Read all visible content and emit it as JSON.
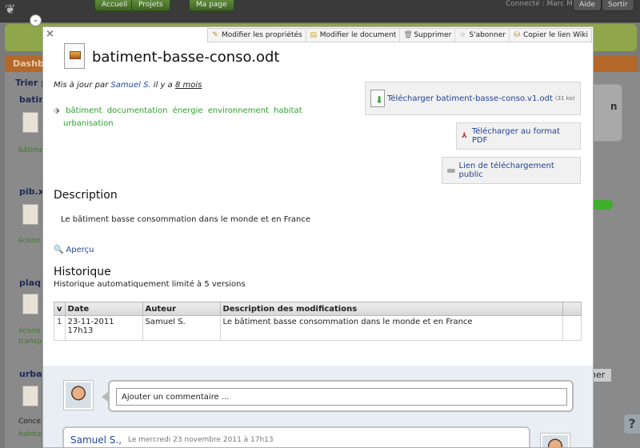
{
  "topbar": {
    "nav": [
      "Accueil",
      "Projets",
      "Ma page"
    ],
    "connected_text": "Connecté : Marc M.",
    "help": "Aide",
    "logout": "Sortir"
  },
  "background": {
    "orangebar_text": "Dashb",
    "sort_label": "Trier p",
    "left_items": [
      "batim",
      "bâtime",
      "pib.x",
      "écono",
      "plaq",
      "écono",
      "transp",
      "urba",
      "Conce",
      "habita"
    ],
    "right_box_text": "n",
    "right_button": "ner",
    "help_button": "?"
  },
  "modal": {
    "actions": [
      {
        "label": "Modifier les propriétés",
        "icon": "pencil-icon",
        "glyph": "✎"
      },
      {
        "label": "Modifier le document",
        "icon": "document-icon",
        "glyph": "▤"
      },
      {
        "label": "Supprimer",
        "icon": "trash-icon",
        "glyph": "🗑"
      },
      {
        "label": "S'abonner",
        "icon": "star-icon",
        "glyph": "☆"
      },
      {
        "label": "Copier le lien Wiki",
        "icon": "wiki-link-icon",
        "glyph": "⛁"
      }
    ],
    "title": "batiment-basse-conso.odt",
    "meta": {
      "prefix": "Mis à jour par",
      "author": "Samuel S.",
      "middle": "il y a",
      "age": "8 mois"
    },
    "tags": [
      "bâtiment",
      "documentation",
      "énergie",
      "environnement",
      "habitat",
      "urbanisation"
    ],
    "downloads": {
      "main_label": "Télécharger batiment-basse-conso.v1.odt",
      "main_size": "(31 ko)",
      "pdf_label": "Télécharger au format PDF",
      "public_label": "Lien de téléchargement public"
    },
    "description_heading": "Description",
    "description_text": "Le bâtiment basse consommation dans le monde et en France",
    "preview_label": "Aperçu",
    "history": {
      "heading": "Historique",
      "subtitle": "Historique automatiquement limité à 5 versions",
      "columns": [
        "v",
        "Date",
        "Auteur",
        "Description des modifications",
        ""
      ],
      "rows": [
        {
          "v": "1",
          "date": "23-11-2011 17h13",
          "author": "Samuel S.",
          "description": "Le bâtiment basse consommation dans le monde et en France"
        }
      ]
    },
    "comments": {
      "input_value": "Ajouter un commentaire ...",
      "first_author": "Samuel S.,",
      "first_date": "Le mercredi 23 novembre 2011 à 17h13"
    }
  }
}
